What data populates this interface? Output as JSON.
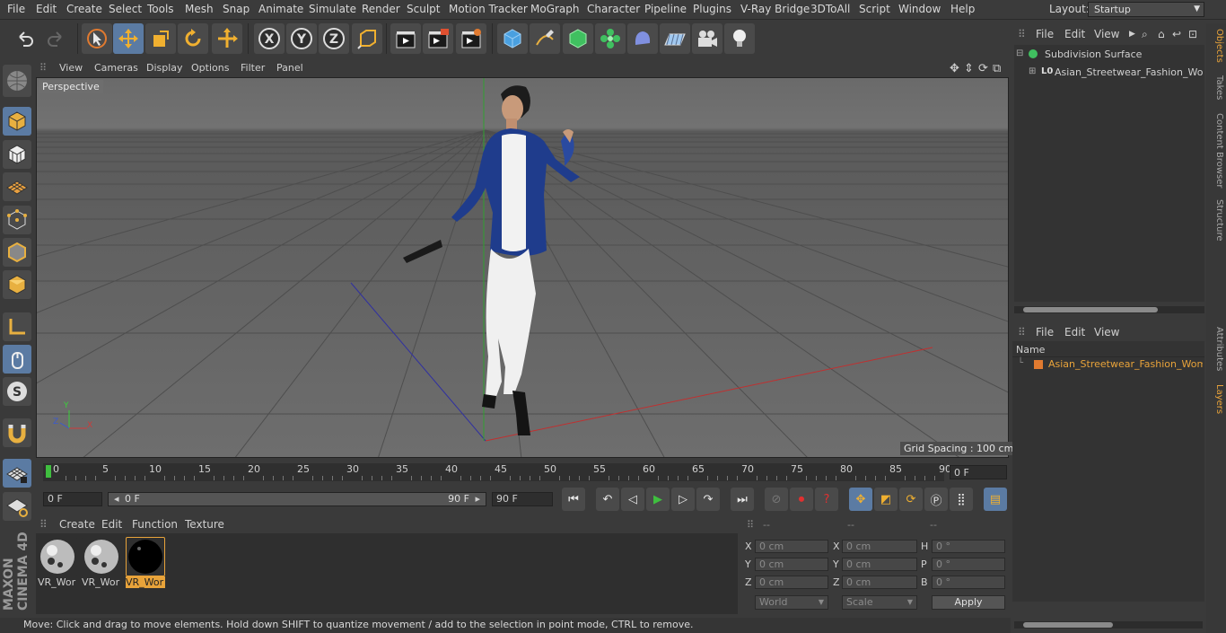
{
  "menubar": {
    "items": [
      "File",
      "Edit",
      "Create",
      "Select",
      "Tools",
      "Mesh",
      "Snap",
      "Animate",
      "Simulate",
      "Render",
      "Sculpt",
      "Motion Tracker",
      "MoGraph",
      "Character",
      "Pipeline",
      "Plugins",
      "V-Ray Bridge",
      "3DToAll",
      "Script",
      "Window",
      "Help"
    ],
    "layout_label": "Layout:",
    "layout_value": "Startup"
  },
  "viewport": {
    "menu": [
      "View",
      "Cameras",
      "Display",
      "Options",
      "Filter",
      "Panel"
    ],
    "camera_label": "Perspective",
    "grid_spacing": "Grid Spacing : 100 cm",
    "axis_labels": {
      "x": "X",
      "y": "Y",
      "z": "Z"
    }
  },
  "timeline": {
    "ticks": [
      "0",
      "5",
      "10",
      "15",
      "20",
      "25",
      "30",
      "35",
      "40",
      "45",
      "50",
      "55",
      "60",
      "65",
      "70",
      "75",
      "80",
      "85",
      "90"
    ],
    "current_frame": "0 F"
  },
  "transport": {
    "start_field": "0 F",
    "range_start": "0 F",
    "range_end": "90 F",
    "end_field": "90 F"
  },
  "material_manager": {
    "menu": [
      "Create",
      "Edit",
      "Function",
      "Texture"
    ],
    "materials": [
      {
        "label": "VR_Wor",
        "selected": false
      },
      {
        "label": "VR_Wor",
        "selected": false
      },
      {
        "label": "VR_Wor",
        "selected": true
      }
    ]
  },
  "coordinates": {
    "headers": [
      "--",
      "--",
      "--"
    ],
    "rows": [
      {
        "a_label": "X",
        "a_value": "0 cm",
        "b_label": "X",
        "b_value": "0 cm",
        "c_label": "H",
        "c_value": "0 °"
      },
      {
        "a_label": "Y",
        "a_value": "0 cm",
        "b_label": "Y",
        "b_value": "0 cm",
        "c_label": "P",
        "c_value": "0 °"
      },
      {
        "a_label": "Z",
        "a_value": "0 cm",
        "b_label": "Z",
        "b_value": "0 cm",
        "c_label": "B",
        "c_value": "0 °"
      }
    ],
    "world_select": "World",
    "scale_select": "Scale",
    "apply_label": "Apply"
  },
  "status_bar": "Move: Click and drag to move elements. Hold down SHIFT to quantize movement / add to the selection in point mode, CTRL to remove.",
  "object_manager": {
    "menu": [
      "File",
      "Edit",
      "View"
    ],
    "objects": [
      {
        "name": "Subdivision Surface"
      },
      {
        "name": "Asian_Streetwear_Fashion_Woma"
      }
    ]
  },
  "layer_manager": {
    "menu": [
      "File",
      "Edit",
      "View"
    ],
    "column_header": "Name",
    "layers": [
      {
        "name": "Asian_Streetwear_Fashion_Woma",
        "color": "#e07a30"
      }
    ]
  },
  "side_tabs": [
    {
      "label": "Objects",
      "active": true
    },
    {
      "label": "Takes",
      "active": false
    },
    {
      "label": "Content Browser",
      "active": false
    },
    {
      "label": "Structure",
      "active": false
    },
    {
      "label": "Attributes",
      "active": false
    },
    {
      "label": "Layers",
      "active": true
    }
  ],
  "brand": "MAXON CINEMA 4D",
  "colors": {
    "accent": "#5b7ba3",
    "highlight": "#e8a33a",
    "play": "#3fbf3f"
  }
}
